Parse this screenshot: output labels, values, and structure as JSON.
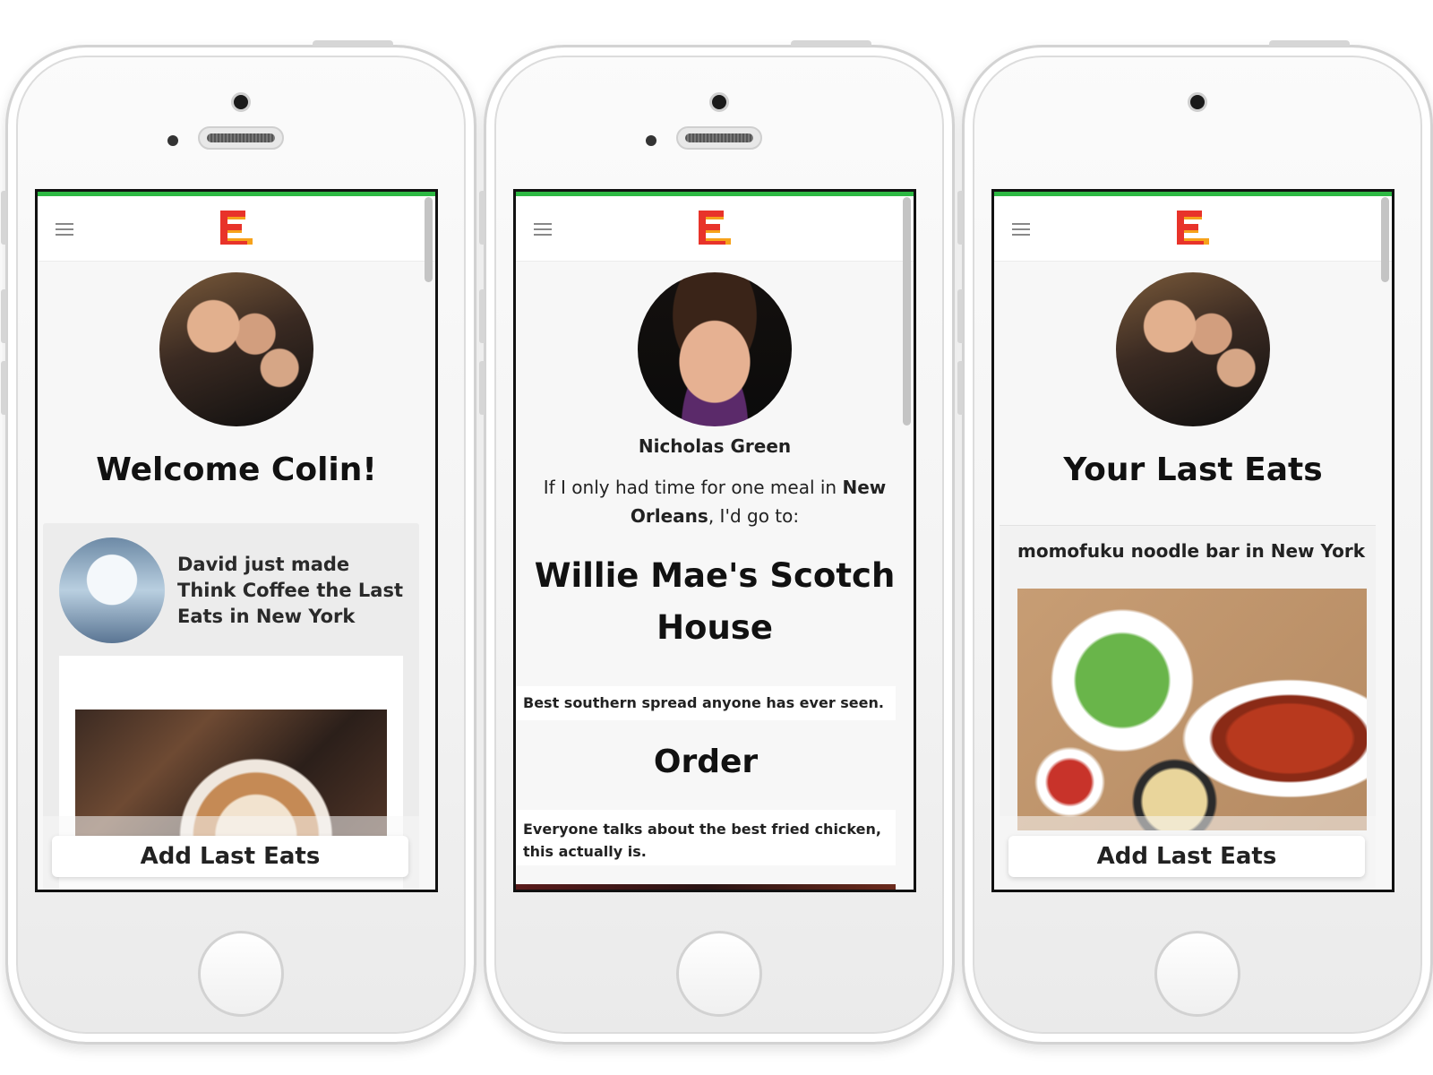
{
  "colors": {
    "accent_green": "#2db843",
    "logo_red": "#e8332a",
    "logo_orange": "#f6a21b",
    "text_dark": "#111111"
  },
  "phones": [
    {
      "screen": "welcome",
      "heading": "Welcome Colin!",
      "feed_text": "David just made Think Coffee the Last Eats in New York",
      "add_button": "Add Last Eats"
    },
    {
      "screen": "profile",
      "name": "Nicholas Green",
      "intro_pre": "If I only had time for one meal in ",
      "intro_city": "New Orleans",
      "intro_post": ", I'd go to:",
      "restaurant": "Willie Mae's Scotch House",
      "description": "Best southern spread anyone has ever seen.",
      "order_heading": "Order",
      "order_text": "Everyone talks about the best fried chicken, this actually is."
    },
    {
      "screen": "last_eats",
      "heading": "Your Last Eats",
      "card_title": "momofuku noodle bar in New York",
      "add_button": "Add Last Eats"
    }
  ],
  "icons": [
    "menu-icon",
    "last-eats-logo-icon"
  ]
}
